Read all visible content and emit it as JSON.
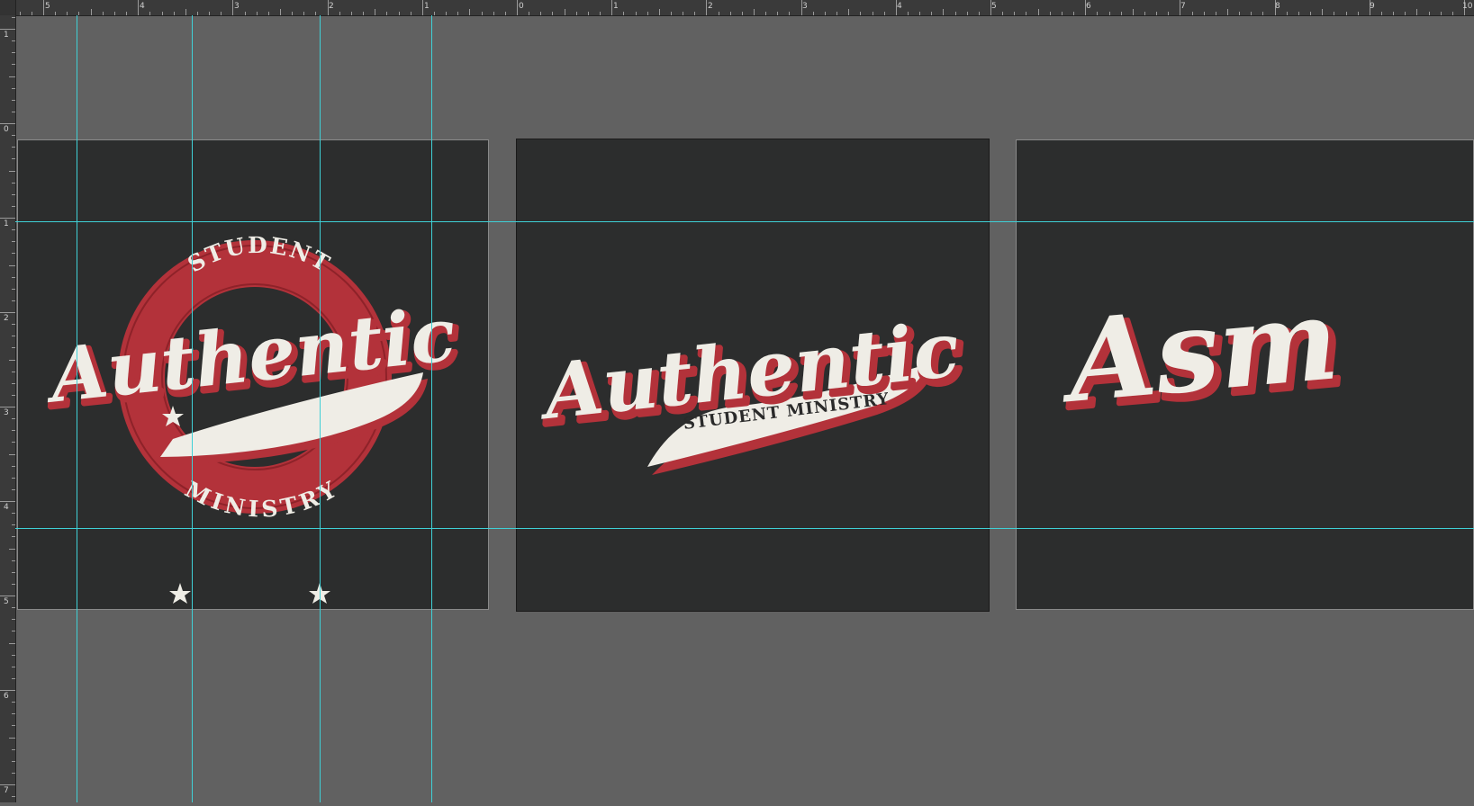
{
  "ruler": {
    "top_labels": [
      "5",
      "4",
      "3",
      "2",
      "1",
      "0",
      "1",
      "2",
      "3",
      "4",
      "5",
      "6",
      "7",
      "8",
      "9",
      "10"
    ],
    "left_labels": [
      "1",
      "0",
      "1",
      "2",
      "3",
      "4",
      "5",
      "6",
      "7"
    ]
  },
  "artboards": [
    {
      "name": "round-badge",
      "main_text": "Authentic",
      "arc_top": "STUDENT",
      "arc_bottom": "MINISTRY"
    },
    {
      "name": "script-swoosh",
      "main_text": "Authentic",
      "banner_text": "STUDENT MINISTRY"
    },
    {
      "name": "monogram",
      "main_text": "Asm"
    }
  ],
  "colors": {
    "app_bg": "#616161",
    "artboard_bg": "#2c2d2d",
    "cream": "#efede6",
    "red": "#b3323a",
    "dark_text": "#2a2a2a",
    "guide": "#3fd0d6"
  }
}
